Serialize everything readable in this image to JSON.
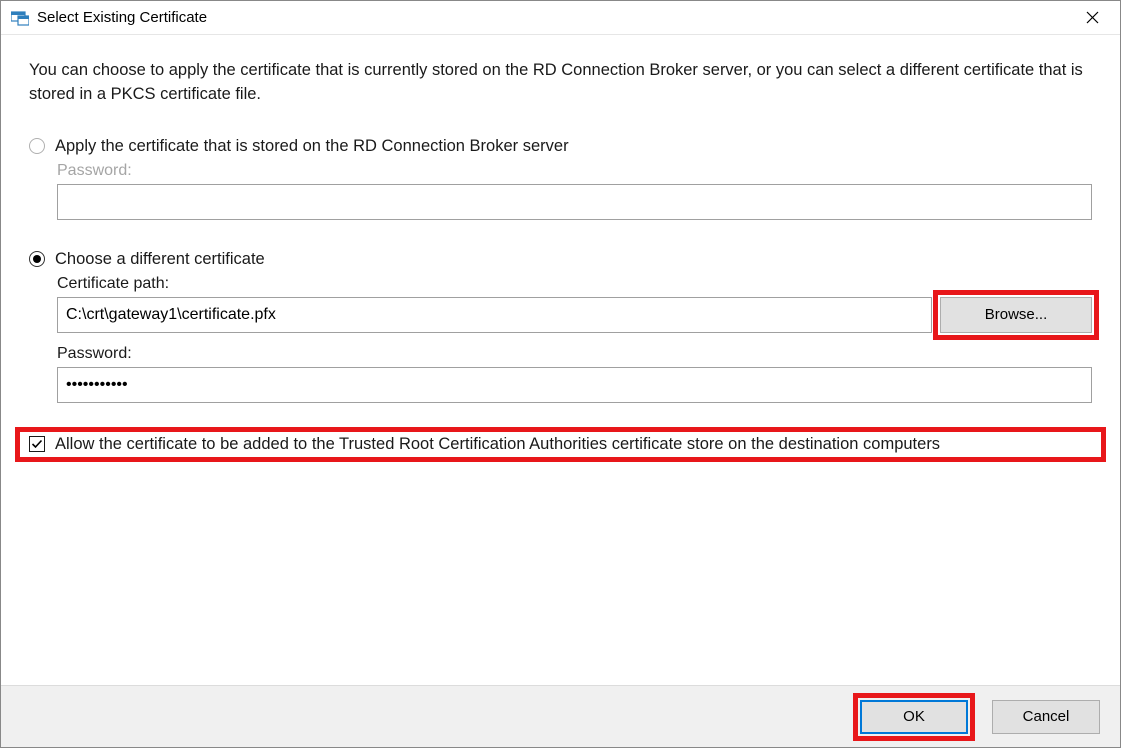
{
  "titlebar": {
    "title": "Select Existing Certificate"
  },
  "intro": {
    "text": "You can choose to apply the certificate that is currently stored on the RD Connection Broker server, or you can select a different certificate that is stored in a PKCS certificate file."
  },
  "option1": {
    "label": "Apply the certificate that is stored on the RD Connection Broker server",
    "password_label": "Password:",
    "password_value": ""
  },
  "option2": {
    "label": "Choose a different certificate",
    "path_label": "Certificate path:",
    "path_value": "C:\\crt\\gateway1\\certificate.pfx",
    "browse_label": "Browse...",
    "password_label": "Password:",
    "password_value": "•••••••••••"
  },
  "checkbox": {
    "label": "Allow the certificate to be added to the Trusted Root Certification Authorities certificate store on the destination computers",
    "checked": true
  },
  "footer": {
    "ok_label": "OK",
    "cancel_label": "Cancel"
  }
}
